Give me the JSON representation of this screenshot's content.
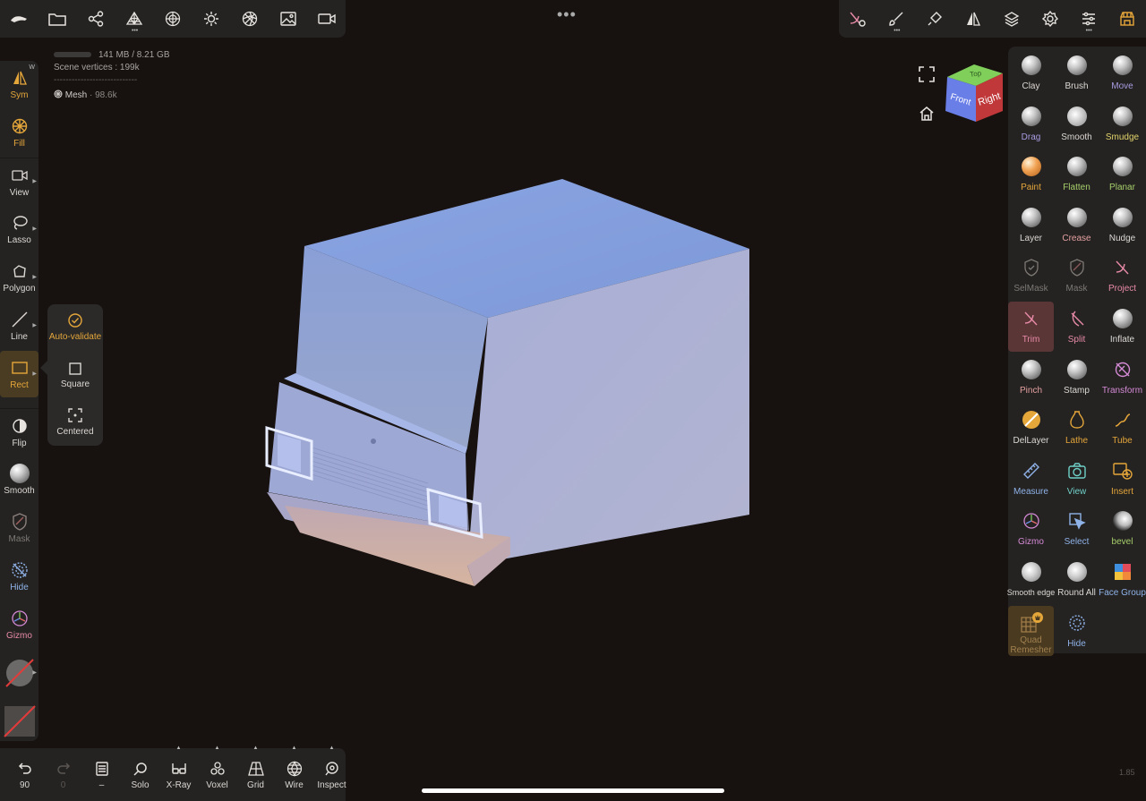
{
  "top_toolbar_left": {
    "icons": [
      "logo-icon",
      "folder-icon",
      "scene-graph-icon",
      "multiresolution-icon",
      "topology-icon",
      "lighting-icon",
      "material-icon",
      "background-icon",
      "camera-icon"
    ]
  },
  "top_toolbar_right": {
    "icons": [
      "trim-tool-icon",
      "paint-brush-icon",
      "stamp-brush-icon",
      "symmetry-icon",
      "layers-icon",
      "settings-icon",
      "sliders-icon",
      "shop-icon"
    ]
  },
  "stats": {
    "memory": "141 MB / 8.21 GB",
    "scene_vertices": "Scene vertices : 199k",
    "divider": "----------------------------",
    "mesh_name": "Mesh",
    "mesh_count": "· 98.6k"
  },
  "left_toolbar": {
    "sym": "Sym",
    "sym_badge": "W",
    "fill": "Fill",
    "view": "View",
    "lasso": "Lasso",
    "polygon": "Polygon",
    "line": "Line",
    "rect": "Rect",
    "flip": "Flip",
    "smooth": "Smooth",
    "mask": "Mask",
    "hide": "Hide",
    "gizmo": "Gizmo"
  },
  "rect_popup": {
    "auto_validate": "Auto-validate",
    "square": "Square",
    "centered": "Centered"
  },
  "view_cube": {
    "front": "Front",
    "right": "Right",
    "top": "Top"
  },
  "tools": [
    {
      "label": "Clay",
      "color": "#dcd8d4"
    },
    {
      "label": "Brush",
      "color": "#dcd8d4"
    },
    {
      "label": "Move",
      "color": "#a89be0"
    },
    {
      "label": "Drag",
      "color": "#a89be0"
    },
    {
      "label": "Smooth",
      "color": "#dcd8d4"
    },
    {
      "label": "Smudge",
      "color": "#e2d36a"
    },
    {
      "label": "Paint",
      "color": "#e5a63a"
    },
    {
      "label": "Flatten",
      "color": "#a7cf6a"
    },
    {
      "label": "Planar",
      "color": "#a7cf6a"
    },
    {
      "label": "Layer",
      "color": "#dcd8d4"
    },
    {
      "label": "Crease",
      "color": "#e5a0a0"
    },
    {
      "label": "Nudge",
      "color": "#dcd8d4"
    },
    {
      "label": "SelMask",
      "color": "#7d7975"
    },
    {
      "label": "Mask",
      "color": "#7d7975"
    },
    {
      "label": "Project",
      "color": "#e88aa8"
    },
    {
      "label": "Trim",
      "color": "#e88aa8"
    },
    {
      "label": "Split",
      "color": "#e88aa8"
    },
    {
      "label": "Inflate",
      "color": "#dcd8d4"
    },
    {
      "label": "Pinch",
      "color": "#e5a0a0"
    },
    {
      "label": "Stamp",
      "color": "#dcd8d4"
    },
    {
      "label": "Transform",
      "color": "#d58ad5"
    },
    {
      "label": "DelLayer",
      "color": "#dcd8d4"
    },
    {
      "label": "Lathe",
      "color": "#e5a63a"
    },
    {
      "label": "Tube",
      "color": "#e5a63a"
    },
    {
      "label": "Measure",
      "color": "#8fb2e8"
    },
    {
      "label": "View",
      "color": "#6fd0c8"
    },
    {
      "label": "Insert",
      "color": "#e5a63a"
    },
    {
      "label": "Gizmo",
      "color": "#d58ad5"
    },
    {
      "label": "Select",
      "color": "#8fb2e8"
    },
    {
      "label": "bevel",
      "color": "#a7cf6a"
    },
    {
      "label": "Smooth edge",
      "color": "#dcd8d4"
    },
    {
      "label": "Round All",
      "color": "#dcd8d4"
    },
    {
      "label": "Face Group",
      "color": "#8fb2e8"
    },
    {
      "label": "Quad Remesher",
      "color": "#a08050"
    },
    {
      "label": "Hide",
      "color": "#8fb2e8"
    }
  ],
  "bottom_toolbar": {
    "undo_count": "90",
    "redo_count": "0",
    "doc_label": "–",
    "solo": "Solo",
    "xray": "X-Ray",
    "voxel": "Voxel",
    "grid": "Grid",
    "wire": "Wire",
    "inspect": "Inspect"
  },
  "version": "1.85"
}
